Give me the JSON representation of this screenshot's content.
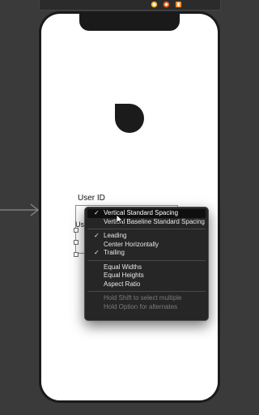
{
  "canvas": {
    "field_label": "User ID",
    "field_text_fragment": "Us"
  },
  "context_menu": {
    "groups": [
      [
        {
          "label": "Vertical Standard Spacing",
          "checked": true,
          "highlighted": true
        },
        {
          "label": "Vertical Baseline Standard Spacing",
          "checked": false
        }
      ],
      [
        {
          "label": "Leading",
          "checked": true
        },
        {
          "label": "Center Horizontally",
          "checked": false
        },
        {
          "label": "Trailing",
          "checked": true
        }
      ],
      [
        {
          "label": "Equal Widths",
          "checked": false
        },
        {
          "label": "Equal Heights",
          "checked": false
        },
        {
          "label": "Aspect Ratio",
          "checked": false
        }
      ],
      [
        {
          "label": "Hold Shift to select multiple",
          "disabled": true
        },
        {
          "label": "Hold Option for alternates",
          "disabled": true
        }
      ]
    ],
    "check_glyph": "✓"
  },
  "colors": {
    "canvas_background": "#3a3a3a",
    "menu_background": "#262626",
    "constraint_line": "#7c8fc4"
  }
}
